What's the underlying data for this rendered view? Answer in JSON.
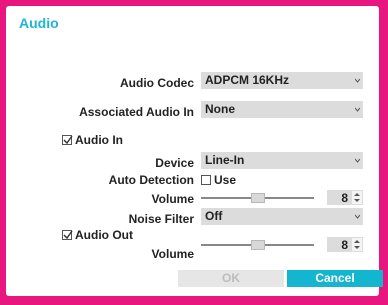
{
  "dialog": {
    "title": "Audio",
    "audio_codec": {
      "label": "Audio Codec",
      "value": "ADPCM 16KHz"
    },
    "associated_audio_in": {
      "label": "Associated Audio In",
      "value": "None"
    },
    "audio_in": {
      "label": "Audio In",
      "checked": true,
      "device": {
        "label": "Device",
        "value": "Line-In"
      },
      "auto_detection": {
        "label": "Auto Detection",
        "option_label": "Use",
        "checked": false
      },
      "volume": {
        "label": "Volume",
        "value": "8",
        "level": 0.5
      },
      "noise_filter": {
        "label": "Noise Filter",
        "value": "Off"
      }
    },
    "audio_out": {
      "label": "Audio Out",
      "checked": true,
      "volume": {
        "label": "Volume",
        "value": "8",
        "level": 0.5
      }
    },
    "buttons": {
      "ok": "OK",
      "cancel": "Cancel"
    }
  },
  "colors": {
    "frame": "#e8177f",
    "accent": "#1fb6d5",
    "cancel_bg": "#13b5cf"
  }
}
